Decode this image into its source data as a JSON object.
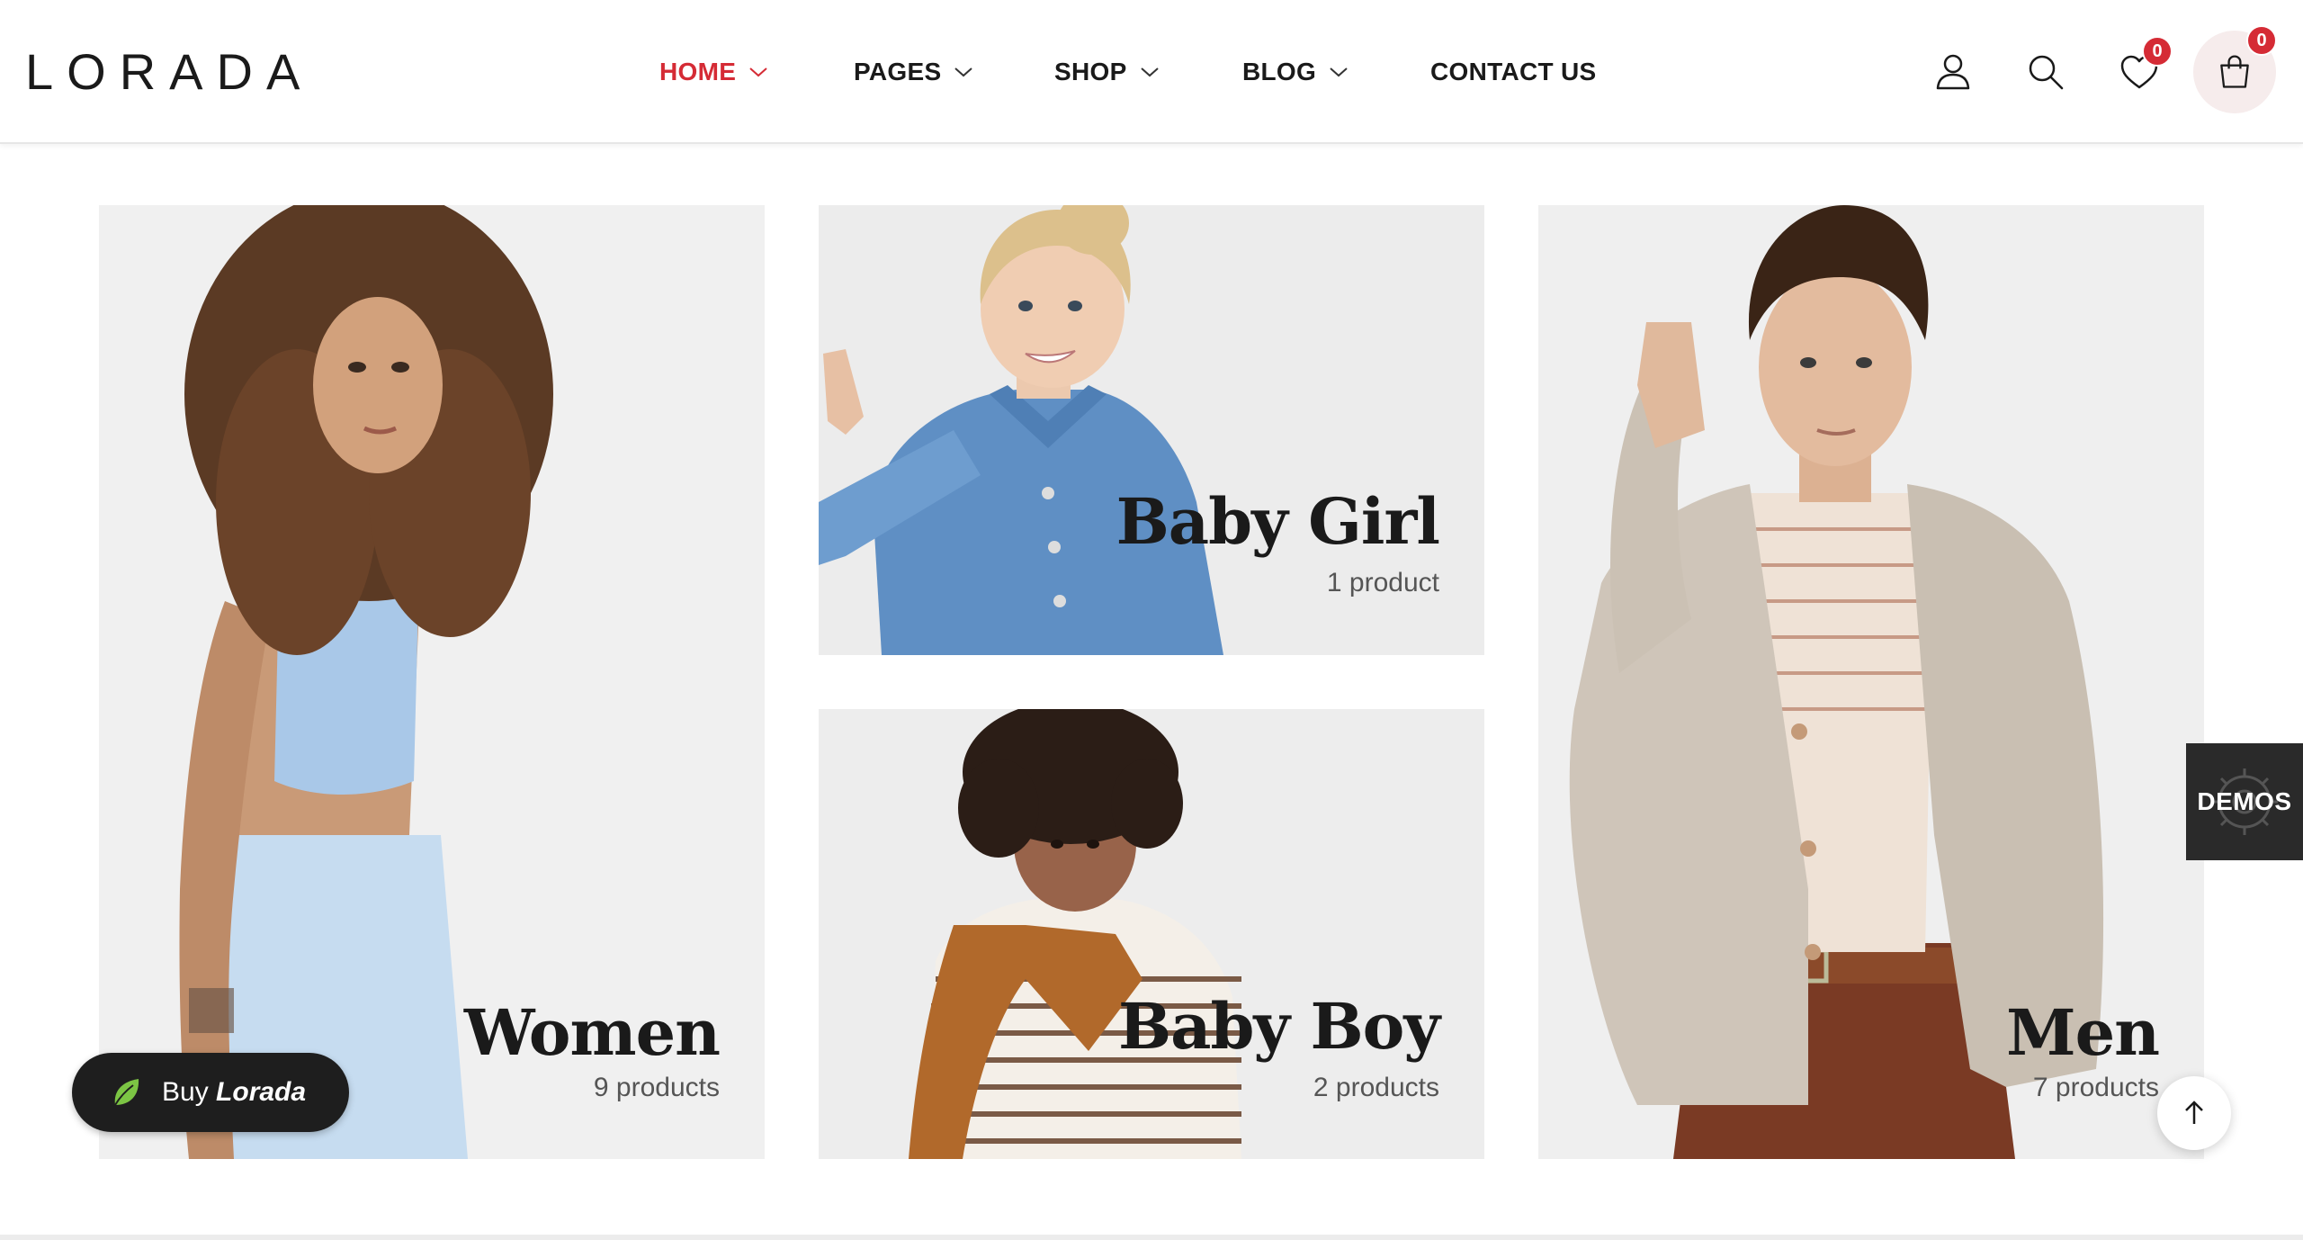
{
  "brand": {
    "logo_text": "LORADA"
  },
  "nav": {
    "items": [
      {
        "label": "HOME",
        "has_dropdown": true,
        "active": true
      },
      {
        "label": "PAGES",
        "has_dropdown": true,
        "active": false
      },
      {
        "label": "SHOP",
        "has_dropdown": true,
        "active": false
      },
      {
        "label": "BLOG",
        "has_dropdown": true,
        "active": false
      },
      {
        "label": "CONTACT US",
        "has_dropdown": false,
        "active": false
      }
    ]
  },
  "header_icons": {
    "account": "user-icon",
    "search": "search-icon",
    "wishlist": "heart-icon",
    "wishlist_count": "0",
    "cart": "shopping-bag-icon",
    "cart_count": "0"
  },
  "categories": [
    {
      "title": "Women",
      "count": "9 products"
    },
    {
      "title": "Baby Girl",
      "count": "1 product"
    },
    {
      "title": "Baby Boy",
      "count": "2 products"
    },
    {
      "title": "Men",
      "count": "7 products"
    }
  ],
  "buy_button": {
    "prefix": "Buy",
    "brand": "Lorada",
    "icon": "leaf-icon"
  },
  "demos_tab": {
    "label": "DEMOS",
    "icon": "gear-icon"
  },
  "scroll_top": {
    "icon": "arrow-up-icon"
  },
  "colors": {
    "accent": "#d52b35",
    "text": "#1a1a1a",
    "tile_bg": "#efefef",
    "badge": "#d52b35",
    "cart_circle": "#f6ecec",
    "buy_button_bg": "#1e1e1e",
    "leaf_green": "#7cc544"
  }
}
